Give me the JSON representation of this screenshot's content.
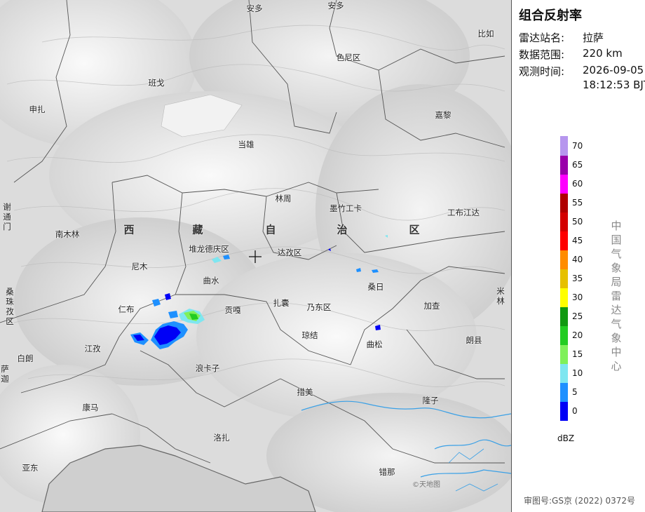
{
  "panel": {
    "title": "组合反射率",
    "station_label": "雷达站名:",
    "station_value": "拉萨",
    "range_label": "数据范围:",
    "range_value": "220 km",
    "time_label": "观测时间:",
    "time_date": "2026-09-05",
    "time_clock": "18:12:53 BJT",
    "unit": "dBZ",
    "agency": "中国气象局雷达气象中心",
    "approval": "审图号:GS京 (2022) 0372号"
  },
  "legend": [
    {
      "label": "0",
      "color": "#0000f6"
    },
    {
      "label": "5",
      "color": "#1e90ff"
    },
    {
      "label": "10",
      "color": "#7ee6f0"
    },
    {
      "label": "15",
      "color": "#7ff05a"
    },
    {
      "label": "20",
      "color": "#22cc22"
    },
    {
      "label": "25",
      "color": "#119911"
    },
    {
      "label": "30",
      "color": "#ffff00"
    },
    {
      "label": "35",
      "color": "#e6c000"
    },
    {
      "label": "40",
      "color": "#ff8c00"
    },
    {
      "label": "45",
      "color": "#ff0000"
    },
    {
      "label": "50",
      "color": "#d40000"
    },
    {
      "label": "55",
      "color": "#b00000"
    },
    {
      "label": "60",
      "color": "#ff00ff"
    },
    {
      "label": "65",
      "color": "#9900aa"
    },
    {
      "label": "70",
      "color": "#b696ee"
    }
  ],
  "map": {
    "watermark": "©天地图",
    "region_chars": [
      "西",
      "藏",
      "自",
      "治",
      "区"
    ],
    "places": [
      "安多",
      "安多",
      "比如",
      "色尼区",
      "班戈",
      "申扎",
      "嘉黎",
      "当雄",
      "林周",
      "墨竹工卡",
      "工布江达",
      "南木林",
      "堆龙德庆区",
      "达孜区",
      "尼木",
      "曲水",
      "桑日",
      "仁布",
      "扎囊",
      "乃东区",
      "贡嘎",
      "加查",
      "琼结",
      "江孜",
      "曲松",
      "朗县",
      "白朗",
      "浪卡子",
      "措美",
      "隆子",
      "康马",
      "洛扎",
      "亚东",
      "错那"
    ],
    "vertical_places": [
      "谢通门",
      "桑珠孜区",
      "米林",
      "萨迦"
    ]
  }
}
